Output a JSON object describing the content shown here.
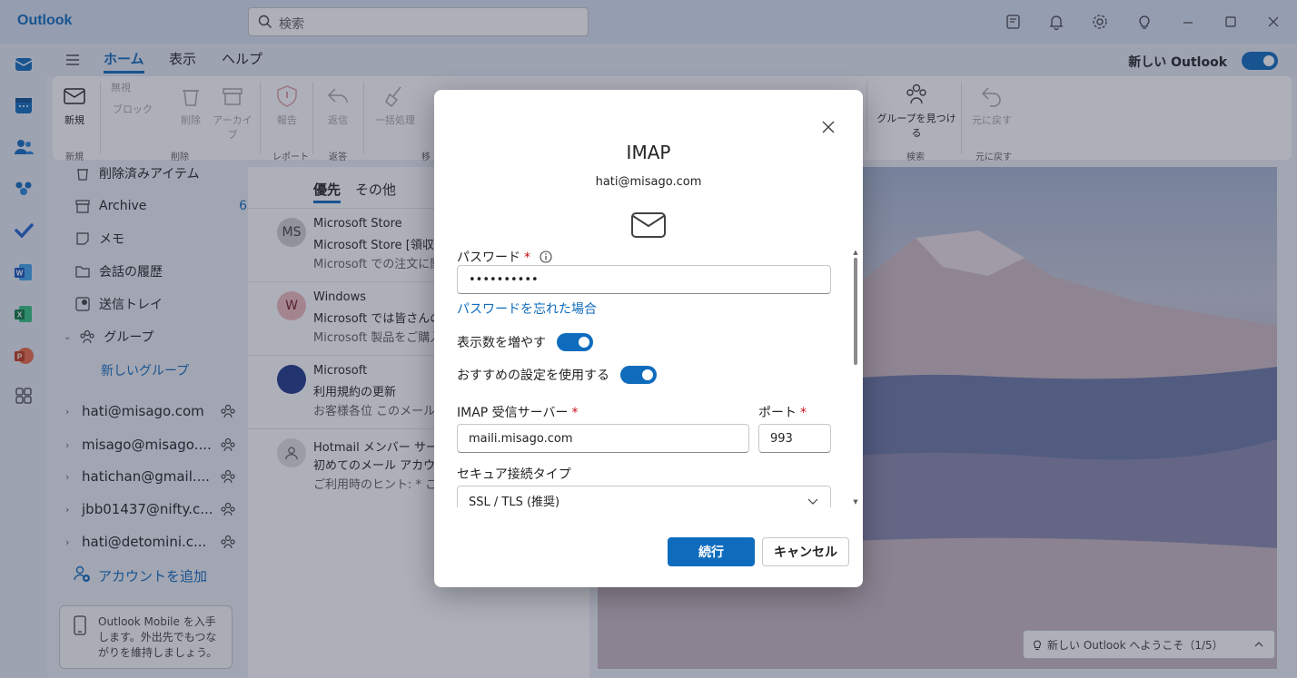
{
  "app": {
    "title": "Outlook",
    "search_placeholder": "検索",
    "new_outlook_label": "新しい Outlook",
    "accent": "#0f6cbd"
  },
  "tabs": [
    {
      "label": "ホーム",
      "active": true
    },
    {
      "label": "表示",
      "active": false
    },
    {
      "label": "ヘルプ",
      "active": false
    }
  ],
  "ribbon": {
    "new_label": "新規",
    "ignore_label": "無視",
    "block_label": "ブロック",
    "delete_label": "削除",
    "archive_label": "アーカイブ",
    "report_label": "報告",
    "reply_label": "返信",
    "sweep_label": "一括処理",
    "find_groups_label": "グループを見つける",
    "undo_label": "元に戻す",
    "groups": {
      "new": "新規",
      "delete": "削除",
      "report": "レポート",
      "respond": "返答",
      "move": "移",
      "search": "検索",
      "undo": "元に戻す"
    }
  },
  "folders": [
    {
      "label": "削除済みアイテム",
      "icon": "trash-icon"
    },
    {
      "label": "Archive",
      "count": "6",
      "icon": "archive-icon"
    },
    {
      "label": "メモ",
      "icon": "note-icon"
    },
    {
      "label": "会話の履歴",
      "icon": "folder-icon"
    },
    {
      "label": "送信トレイ",
      "icon": "outbox-icon"
    },
    {
      "label": "グループ",
      "icon": "people-icon"
    },
    {
      "label": "新しいグループ"
    }
  ],
  "accounts": [
    "hati@misago.com",
    "misago@misago....",
    "hatichan@gmail....",
    "jbb01437@nifty.c...",
    "hati@detomini.c..."
  ],
  "add_account_label": "アカウントを追加",
  "mobile_promo": "Outlook Mobile を入手します。外出先でもつながりを維持しましょう。",
  "mail_tabs": [
    "優先",
    "その他"
  ],
  "mails": [
    {
      "avatar": "MS",
      "from": "Microsoft Store",
      "subject": "Microsoft Store [領収",
      "preview": "Microsoft での注文に関",
      "avatar_bg": "#d1d1d1",
      "avatar_fg": "#424242"
    },
    {
      "avatar": "W",
      "from": "Windows",
      "subject": "Microsoft では皆さんの",
      "preview": "Microsoft 製品をご購入",
      "avatar_bg": "#f1bbbc",
      "avatar_fg": "#751d1f"
    },
    {
      "avatar": "",
      "from": "Microsoft",
      "subject": "利用規約の更新",
      "preview": "お客様各位 このメールは",
      "avatar_bg": "#1f3a8a",
      "avatar_fg": "#ffffff"
    },
    {
      "avatar": "",
      "from": "Hotmail メンバー サービス",
      "subject": "初めてのメール アカウント",
      "preview": "ご利用時のヒント: * このア",
      "avatar_bg": "#e0e0e0",
      "avatar_fg": "#616161"
    }
  ],
  "welcome_bar": "新しい Outlook へようこそ（1/5）",
  "dialog": {
    "title": "IMAP",
    "email": "hati@misago.com",
    "password_label": "パスワード",
    "password_value": "••••••••••",
    "forgot_password": "パスワードを忘れた場合",
    "show_more_label": "表示数を増やす",
    "recommended_label": "おすすめの設定を使用する",
    "imap_server_label": "IMAP 受信サーバー",
    "imap_server_value": "maili.misago.com",
    "port_label": "ポート",
    "port_value": "993",
    "secure_type_label": "セキュア接続タイプ",
    "secure_type_value": "SSL / TLS (推奨)",
    "required_mark": "*",
    "continue_label": "続行",
    "cancel_label": "キャンセル"
  }
}
